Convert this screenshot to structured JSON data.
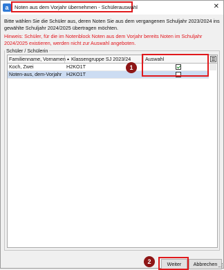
{
  "window": {
    "title": "Noten aus dem Vorjahr übernehmen - Schülerauswahl",
    "app_icon_letter": "a",
    "close_glyph": "✕"
  },
  "intro_text": "Bitte wählen Sie die Schüler aus, deren Noten Sie aus dem vergangenen Schuljahr 2023/2024 ins gewählte Schuljahr 2024/2025 übertragen möchten.",
  "hint_text": "Hinweis: Schüler, für die im Notenblock Noten aus dem Vorjahr bereits Noten im Schuljahr 2024/2025 existieren, werden nicht zur Auswahl angeboten.",
  "group_label": "Schüler / Schülerin",
  "table": {
    "columns": [
      "Familienname, Vornamen",
      "Klassengruppe SJ 2023/24",
      "Auswahl"
    ],
    "sort_glyph": "▲",
    "rows": [
      {
        "name": "Koch, Zwei",
        "klasse": "H2KO1T",
        "selected": true
      },
      {
        "name": "Noten-aus, dem-Vorjahr",
        "klasse": "H2KO1T",
        "selected": false
      }
    ]
  },
  "markers": {
    "one": "1",
    "two": "2"
  },
  "buttons": {
    "next": "Weiter",
    "cancel": "Abbrechen"
  },
  "colors": {
    "highlight": "#e0191c",
    "hint": "#e2141b",
    "row_selected": "#ccdcf2",
    "marker": "#8e1616"
  }
}
